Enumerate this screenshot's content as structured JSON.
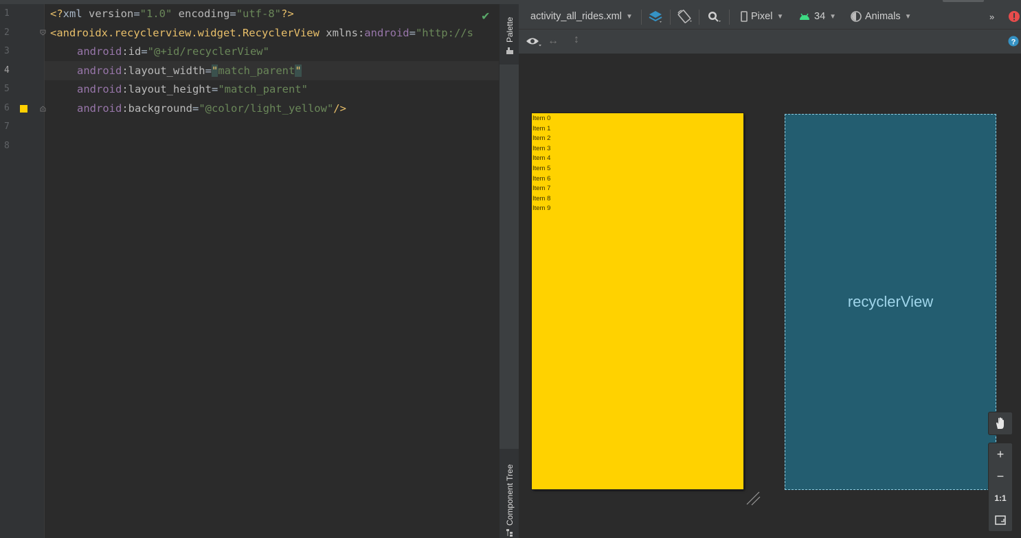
{
  "editor": {
    "line_numbers": [
      "1",
      "2",
      "3",
      "4",
      "5",
      "6",
      "7",
      "8"
    ],
    "current_line": "4",
    "lines": [
      [
        {
          "t": "<?",
          "c": "pi"
        },
        {
          "t": "xml ",
          "c": "punc"
        },
        {
          "t": "version",
          "c": "attr"
        },
        {
          "t": "=",
          "c": "punc"
        },
        {
          "t": "\"1.0\"",
          "c": "str"
        },
        {
          "t": " encoding",
          "c": "attr"
        },
        {
          "t": "=",
          "c": "punc"
        },
        {
          "t": "\"utf-8\"",
          "c": "str"
        },
        {
          "t": "?>",
          "c": "pi"
        }
      ],
      [
        {
          "t": "<androidx.recyclerview.widget.RecyclerView ",
          "c": "tag"
        },
        {
          "t": "xmlns:",
          "c": "attr"
        },
        {
          "t": "android",
          "c": "ns"
        },
        {
          "t": "=",
          "c": "punc"
        },
        {
          "t": "\"http://s",
          "c": "str"
        }
      ],
      [
        {
          "t": "android",
          "c": "ns"
        },
        {
          "t": ":id",
          "c": "attr"
        },
        {
          "t": "=",
          "c": "punc"
        },
        {
          "t": "\"@+id/recyclerView\"",
          "c": "str"
        }
      ],
      [
        {
          "t": "android",
          "c": "ns"
        },
        {
          "t": ":layout_width",
          "c": "attr"
        },
        {
          "t": "=",
          "c": "punc"
        },
        {
          "t": "\"",
          "c": "q"
        },
        {
          "t": "match_parent",
          "c": "str"
        },
        {
          "t": "\"",
          "c": "q"
        }
      ],
      [
        {
          "t": "android",
          "c": "ns"
        },
        {
          "t": ":layout_height",
          "c": "attr"
        },
        {
          "t": "=",
          "c": "punc"
        },
        {
          "t": "\"match_parent\"",
          "c": "str"
        }
      ],
      [
        {
          "t": "android",
          "c": "ns"
        },
        {
          "t": ":background",
          "c": "attr"
        },
        {
          "t": "=",
          "c": "punc"
        },
        {
          "t": "\"@color/light_yellow\"",
          "c": "str"
        },
        {
          "t": "/>",
          "c": "tag"
        }
      ],
      [],
      []
    ]
  },
  "side_tabs": {
    "palette": "Palette",
    "component_tree": "Component Tree"
  },
  "toolbar": {
    "file_name": "activity_all_rides.xml",
    "device": "Pixel",
    "api_level": "34",
    "theme": "Animals"
  },
  "preview": {
    "items": [
      "Item 0",
      "Item 1",
      "Item 2",
      "Item 3",
      "Item 4",
      "Item 5",
      "Item 6",
      "Item 7",
      "Item 8",
      "Item 9"
    ],
    "blueprint_label": "recyclerView",
    "background_color": "#ffd200",
    "blueprint_color": "#235d70"
  },
  "zoom": {
    "one_to_one": "1:1"
  },
  "icons": [
    "check-icon",
    "eye-icon",
    "help-icon",
    "error-icon",
    "layers-icon",
    "rotate-icon",
    "zoom-icon",
    "phone-icon",
    "android-icon",
    "theme-icon",
    "hand-icon",
    "plus-icon",
    "minus-icon",
    "fit-screen-icon",
    "resize-handle-icon"
  ]
}
